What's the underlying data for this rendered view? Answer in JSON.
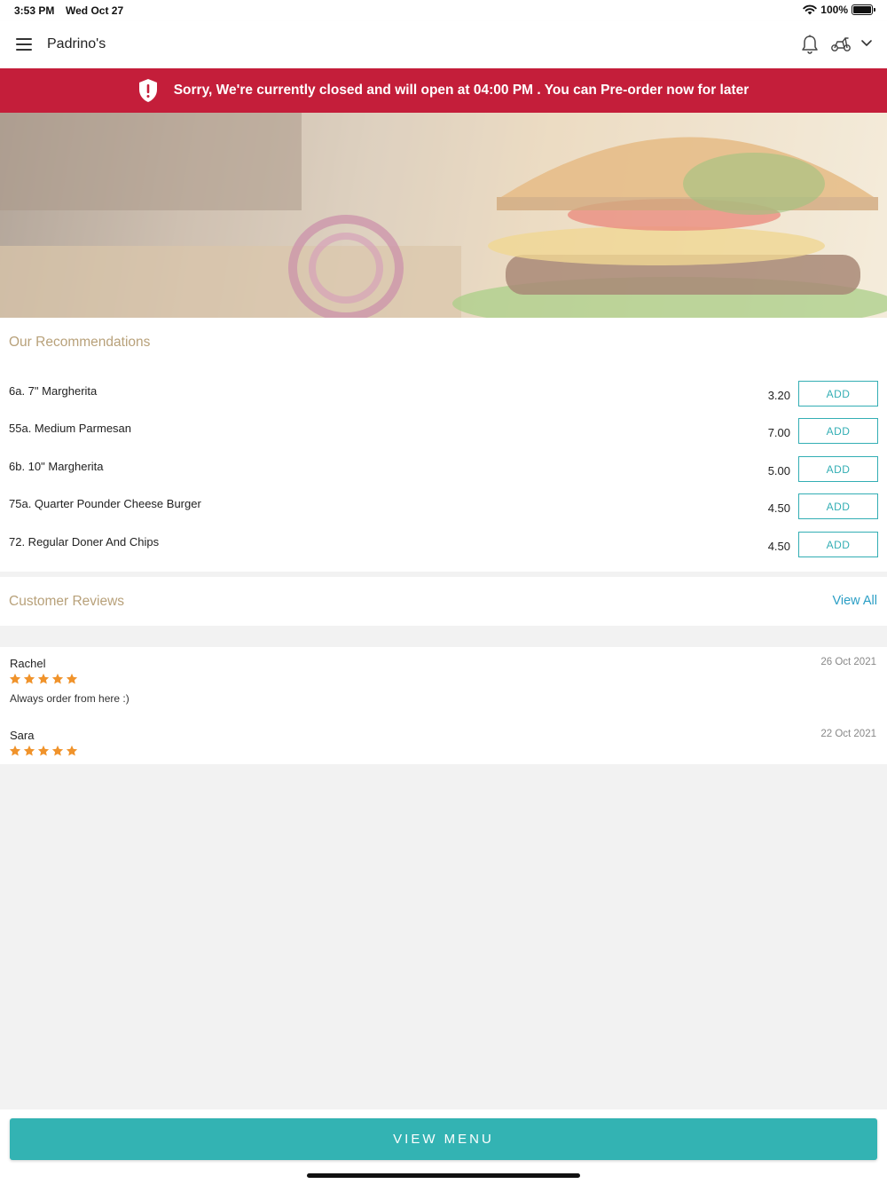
{
  "status_bar": {
    "time": "3:53 PM",
    "date": "Wed Oct 27",
    "battery": "100%",
    "battery_level": 1.0
  },
  "header": {
    "title": "Padrino's",
    "icons": [
      "menu-icon",
      "bell-icon",
      "scooter-icon",
      "chevron-down-icon"
    ]
  },
  "banner": {
    "text": "Sorry, We're currently closed and will open at 04:00 PM . You can Pre-order now for later",
    "color": "#c41e3a"
  },
  "recommendations": {
    "title": "Our Recommendations",
    "items": [
      {
        "name": "6a. 7\" Margherita",
        "price": "3.20",
        "button": "ADD"
      },
      {
        "name": "55a. Medium Parmesan",
        "price": "7.00",
        "button": "ADD"
      },
      {
        "name": "6b. 10\" Margherita",
        "price": "5.00",
        "button": "ADD"
      },
      {
        "name": "75a. Quarter Pounder Cheese Burger",
        "price": "4.50",
        "button": "ADD"
      },
      {
        "name": "72. Regular Doner And Chips",
        "price": "4.50",
        "button": "ADD"
      }
    ]
  },
  "reviews": {
    "title": "Customer Reviews",
    "view_all": "View All",
    "items": [
      {
        "name": "Rachel",
        "date": "26 Oct 2021",
        "rating": 5,
        "text": "Always order from here :)"
      },
      {
        "name": "Sara",
        "date": "22 Oct 2021",
        "rating": 5,
        "text": ""
      }
    ]
  },
  "footer": {
    "button": "VIEW MENU"
  },
  "colors": {
    "accent": "#33b3b3",
    "title_gold": "#b8a17a",
    "link": "#2a9ec5",
    "star": "#f0932b"
  }
}
